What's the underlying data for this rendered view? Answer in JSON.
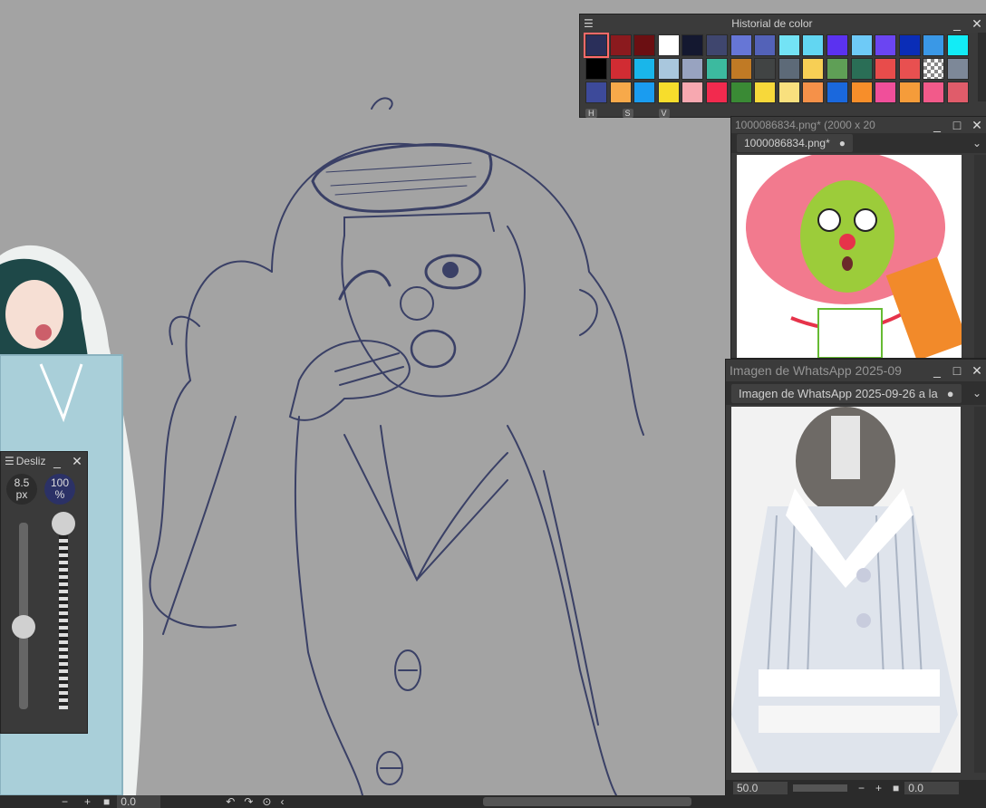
{
  "color_history": {
    "title": "Historial de color",
    "hsv_labels": [
      "H",
      "S",
      "V"
    ],
    "colors": [
      "#2a2f5a",
      "#8b1a1e",
      "#6b0f12",
      "#ffffff",
      "#141830",
      "#3f466e",
      "#6676d6",
      "#5362b8",
      "#73e3f5",
      "#62d6f2",
      "#5b32f0",
      "#6ecaf7",
      "#6b45f2",
      "#0a2db7",
      "#3a98e6",
      "#12ecf6",
      "#000000",
      "#d12c33",
      "#19b6ea",
      "#a9c7dd",
      "#98a3c0",
      "#3cba9f",
      "#c07a25",
      "#414444",
      "#5d6a78",
      "#f7cf55",
      "#5f9f56",
      "#2a6e56",
      "#e84c4b",
      "#e85050",
      "checker",
      "#7d8898",
      "#3d4a9a",
      "#f7a94a",
      "#1a9cf0",
      "#f7dd2c",
      "#f7a8b0",
      "#f22a4e",
      "#3a8a35",
      "#f7d83a",
      "#f9e07e",
      "#f59149",
      "#1a68dd",
      "#f78e2a",
      "#f04f9a",
      "#f59c3a",
      "#f25a8a",
      "#e05c6a"
    ]
  },
  "brush_panel": {
    "title": "Desliz",
    "size_value": "8.5",
    "size_unit": "px",
    "opacity_value": "100",
    "opacity_unit": "%"
  },
  "ref_window_1": {
    "title": "1000086834.png* (2000 x 20",
    "tab_label": "1000086834.png*"
  },
  "ref_window_2": {
    "title": "Imagen de WhatsApp 2025-09",
    "tab_label": "Imagen de WhatsApp 2025-09-26 a la"
  },
  "ref_bottom": {
    "zoom": "50.0",
    "angle": "0.0"
  },
  "main_bottom": {
    "angle": "0.0"
  }
}
